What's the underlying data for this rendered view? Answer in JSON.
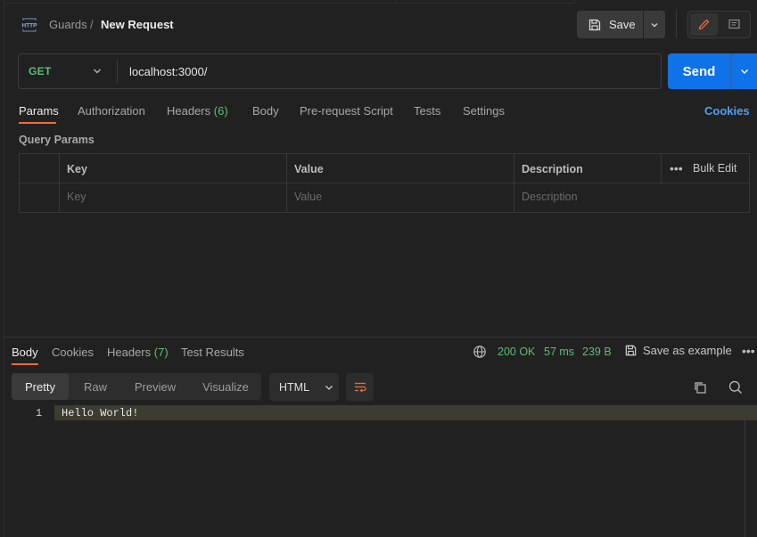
{
  "header": {
    "collection": "Guards",
    "separator": "/",
    "request_name": "New Request",
    "save_label": "Save"
  },
  "request": {
    "method": "GET",
    "url": "localhost:3000/",
    "send_label": "Send"
  },
  "request_tabs": [
    {
      "label": "Params",
      "active": true
    },
    {
      "label": "Authorization"
    },
    {
      "label": "Headers",
      "count": "(6)"
    },
    {
      "label": "Body"
    },
    {
      "label": "Pre-request Script"
    },
    {
      "label": "Tests"
    },
    {
      "label": "Settings"
    }
  ],
  "cookies_link": "Cookies",
  "query_params": {
    "title": "Query Params",
    "columns": [
      "Key",
      "Value",
      "Description"
    ],
    "bulk_edit": "Bulk Edit",
    "placeholders": {
      "key": "Key",
      "value": "Value",
      "description": "Description"
    }
  },
  "response_tabs": [
    {
      "label": "Body",
      "active": true
    },
    {
      "label": "Cookies"
    },
    {
      "label": "Headers",
      "count": "(7)"
    },
    {
      "label": "Test Results"
    }
  ],
  "response_status": {
    "status": "200 OK",
    "time": "57 ms",
    "size": "239 B",
    "save_example": "Save as example"
  },
  "view_modes": [
    {
      "label": "Pretty",
      "active": true
    },
    {
      "label": "Raw"
    },
    {
      "label": "Preview"
    },
    {
      "label": "Visualize"
    }
  ],
  "format": "HTML",
  "response_body": {
    "lines": [
      {
        "number": "1",
        "text": "Hello World!"
      }
    ]
  },
  "colors": {
    "accent_orange": "#f26b3a",
    "send_blue": "#0f72e8",
    "status_green": "#5fbd73",
    "link_blue": "#4ea0ef"
  },
  "icons": [
    "http-icon",
    "save-icon",
    "chevron-down-icon",
    "pencil-icon",
    "comment-icon",
    "globe-icon",
    "ellipsis-icon",
    "text-wrap-icon",
    "copy-icon",
    "search-icon"
  ]
}
